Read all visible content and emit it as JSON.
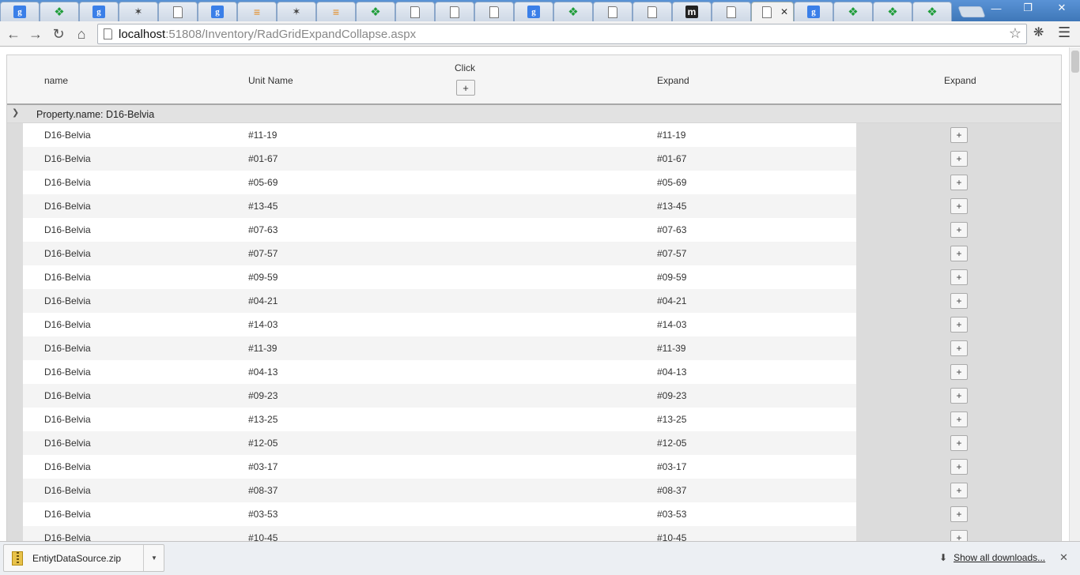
{
  "browser": {
    "tabs": [
      {
        "icon": "google"
      },
      {
        "icon": "dev"
      },
      {
        "icon": "google"
      },
      {
        "icon": "nav"
      },
      {
        "icon": "doc"
      },
      {
        "icon": "google"
      },
      {
        "icon": "stack"
      },
      {
        "icon": "nav"
      },
      {
        "icon": "stack"
      },
      {
        "icon": "dev"
      },
      {
        "icon": "doc"
      },
      {
        "icon": "doc"
      },
      {
        "icon": "doc"
      },
      {
        "icon": "google"
      },
      {
        "icon": "dev"
      },
      {
        "icon": "doc"
      },
      {
        "icon": "doc"
      },
      {
        "icon": "m"
      },
      {
        "icon": "doc"
      },
      {
        "icon": "doc",
        "active": true
      },
      {
        "icon": "google"
      },
      {
        "icon": "dev"
      },
      {
        "icon": "dev"
      },
      {
        "icon": "dev"
      }
    ],
    "url_host": "localhost",
    "url_rest": ":51808/Inventory/RadGridExpandCollapse.aspx"
  },
  "grid": {
    "headers": {
      "name": "name",
      "unit_name": "Unit Name",
      "click": "Click",
      "click_button": "+",
      "expand": "Expand",
      "expand2": "Expand"
    },
    "group_label": "Property.name: D16-Belvia",
    "row_button": "+",
    "rows": [
      {
        "name": "D16-Belvia",
        "unit": "#11-19",
        "expand": "#11-19"
      },
      {
        "name": "D16-Belvia",
        "unit": "#01-67",
        "expand": "#01-67"
      },
      {
        "name": "D16-Belvia",
        "unit": "#05-69",
        "expand": "#05-69"
      },
      {
        "name": "D16-Belvia",
        "unit": "#13-45",
        "expand": "#13-45"
      },
      {
        "name": "D16-Belvia",
        "unit": "#07-63",
        "expand": "#07-63"
      },
      {
        "name": "D16-Belvia",
        "unit": "#07-57",
        "expand": "#07-57"
      },
      {
        "name": "D16-Belvia",
        "unit": "#09-59",
        "expand": "#09-59"
      },
      {
        "name": "D16-Belvia",
        "unit": "#04-21",
        "expand": "#04-21"
      },
      {
        "name": "D16-Belvia",
        "unit": "#14-03",
        "expand": "#14-03"
      },
      {
        "name": "D16-Belvia",
        "unit": "#11-39",
        "expand": "#11-39"
      },
      {
        "name": "D16-Belvia",
        "unit": "#04-13",
        "expand": "#04-13"
      },
      {
        "name": "D16-Belvia",
        "unit": "#09-23",
        "expand": "#09-23"
      },
      {
        "name": "D16-Belvia",
        "unit": "#13-25",
        "expand": "#13-25"
      },
      {
        "name": "D16-Belvia",
        "unit": "#12-05",
        "expand": "#12-05"
      },
      {
        "name": "D16-Belvia",
        "unit": "#03-17",
        "expand": "#03-17"
      },
      {
        "name": "D16-Belvia",
        "unit": "#08-37",
        "expand": "#08-37"
      },
      {
        "name": "D16-Belvia",
        "unit": "#03-53",
        "expand": "#03-53"
      },
      {
        "name": "D16-Belvia",
        "unit": "#10-45",
        "expand": "#10-45"
      }
    ]
  },
  "downloads": {
    "file_name": "EntiytDataSource.zip",
    "show_all": "Show all downloads..."
  }
}
